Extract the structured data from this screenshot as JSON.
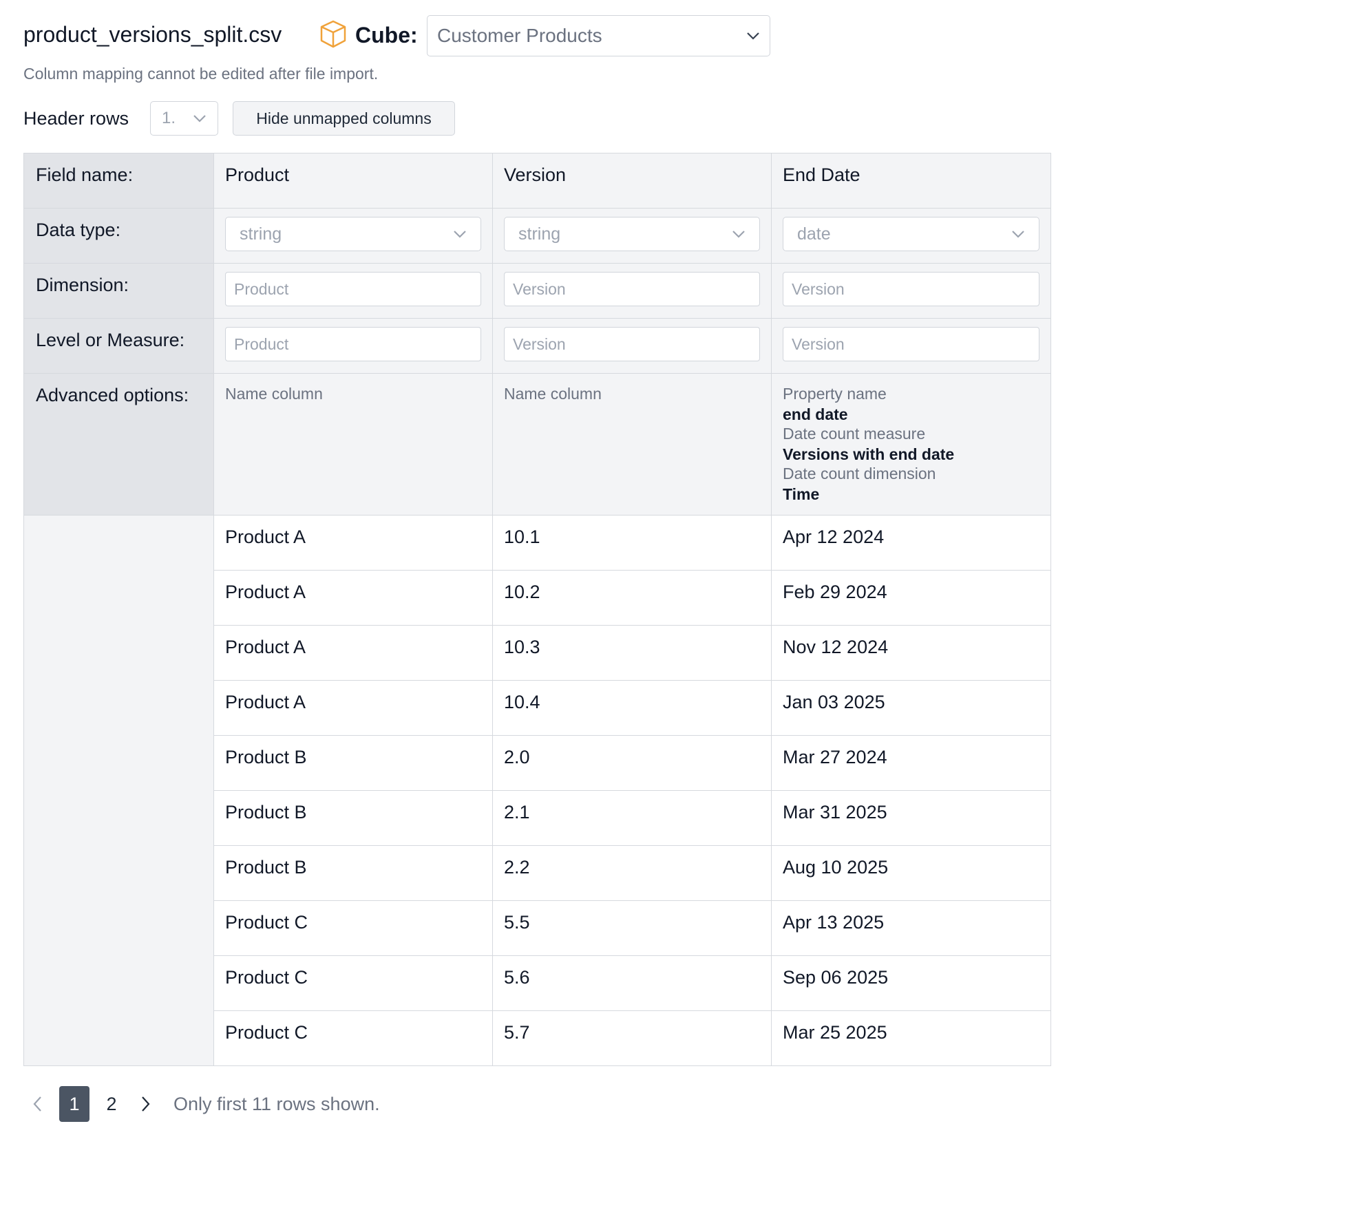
{
  "header": {
    "filename": "product_versions_split.csv",
    "cube_label": "Cube:",
    "cube_selected": "Customer Products",
    "note": "Column mapping cannot be edited after file import."
  },
  "controls": {
    "header_rows_label": "Header rows",
    "header_rows_value": "1.",
    "hide_unmapped_label": "Hide unmapped columns"
  },
  "mapping": {
    "labels": {
      "field_name": "Field name:",
      "data_type": "Data type:",
      "dimension": "Dimension:",
      "level_or_measure": "Level or Measure:",
      "advanced_options": "Advanced options:"
    },
    "columns": [
      {
        "field_name": "Product",
        "data_type": "string",
        "dimension_placeholder": "Product",
        "level_placeholder": "Product",
        "advanced": [
          "Name column"
        ]
      },
      {
        "field_name": "Version",
        "data_type": "string",
        "dimension_placeholder": "Version",
        "level_placeholder": "Version",
        "advanced": [
          "Name column"
        ]
      },
      {
        "field_name": "End Date",
        "data_type": "date",
        "dimension_placeholder": "Version",
        "level_placeholder": "Version",
        "advanced": [
          "Property name",
          "end date",
          "Date count measure",
          "Versions with end date",
          "Date count dimension",
          "Time"
        ]
      }
    ]
  },
  "rows": [
    [
      "Product A",
      "10.1",
      "Apr 12 2024"
    ],
    [
      "Product A",
      "10.2",
      "Feb 29 2024"
    ],
    [
      "Product A",
      "10.3",
      "Nov 12 2024"
    ],
    [
      "Product A",
      "10.4",
      "Jan 03 2025"
    ],
    [
      "Product B",
      "2.0",
      "Mar 27 2024"
    ],
    [
      "Product B",
      "2.1",
      "Mar 31 2025"
    ],
    [
      "Product B",
      "2.2",
      "Aug 10 2025"
    ],
    [
      "Product C",
      "5.5",
      "Apr 13 2025"
    ],
    [
      "Product C",
      "5.6",
      "Sep 06 2025"
    ],
    [
      "Product C",
      "5.7",
      "Mar 25 2025"
    ]
  ],
  "pagination": {
    "pages": [
      "1",
      "2"
    ],
    "current": "1",
    "note": "Only first 11 rows shown."
  },
  "colors": {
    "cube_icon": "#f0a23a",
    "active_page": "#4b5563"
  }
}
